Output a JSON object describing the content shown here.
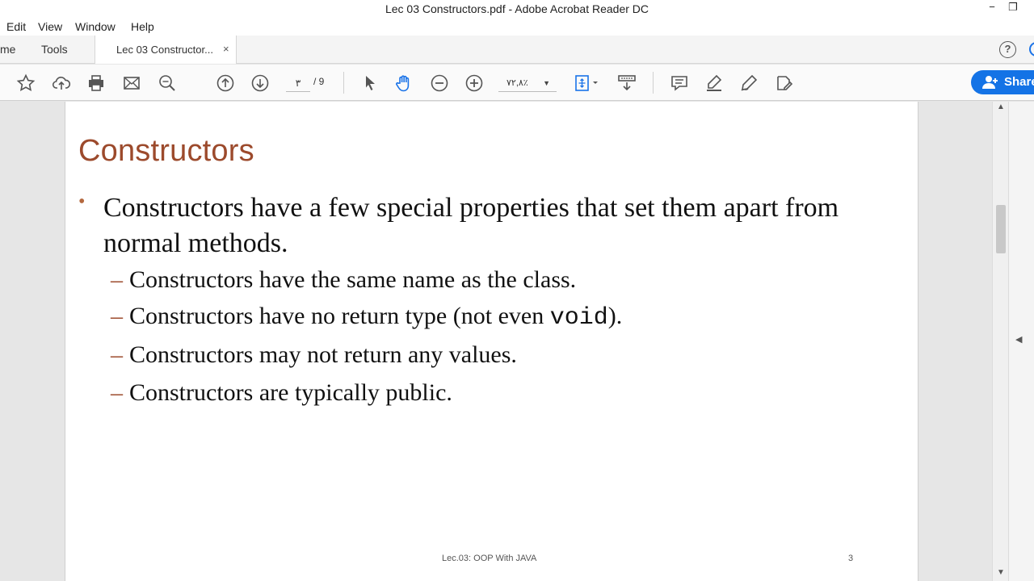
{
  "window": {
    "title": "Lec 03 Constructors.pdf - Adobe Acrobat Reader DC",
    "minimize": "−",
    "restore": "❐"
  },
  "menu": [
    "Edit",
    "View",
    "Window",
    "Help"
  ],
  "tabs": {
    "home": "me",
    "tools": "Tools",
    "document": "Lec 03 Constructor...",
    "close": "×"
  },
  "help_label": "?",
  "toolbar": {
    "current_page": "٣",
    "total_pages": "/ 9",
    "zoom": "٧٢,٨٪",
    "share_label": "Share",
    "icons": [
      "star-icon",
      "cloud-upload-icon",
      "print-icon",
      "email-icon",
      "search-icon",
      "page-up-icon",
      "page-down-icon",
      "select-cursor-icon",
      "hand-tool-icon",
      "zoom-out-icon",
      "zoom-in-icon",
      "fit-page-icon",
      "scroll-mode-icon",
      "comment-icon",
      "highlight-icon",
      "sign-icon",
      "share-edit-icon"
    ]
  },
  "slide": {
    "title": "Constructors",
    "bullet_symbol": "•",
    "main_point": "Constructors have a few special properties that set them apart from normal methods.",
    "dash": "–",
    "sub_points": [
      {
        "text": "Constructors have the same name as the class."
      },
      {
        "pre": "Constructors have no return type (not even ",
        "code": "void",
        "post": ")."
      },
      {
        "text": "Constructors may not return any values."
      },
      {
        "text": "Constructors are typically public."
      }
    ],
    "footer": "Lec.03: OOP With JAVA",
    "page_number": "3"
  },
  "colors": {
    "title": "#9c4a2c",
    "accent_blue": "#1473e6",
    "icon_blue": "#1a73e8"
  }
}
